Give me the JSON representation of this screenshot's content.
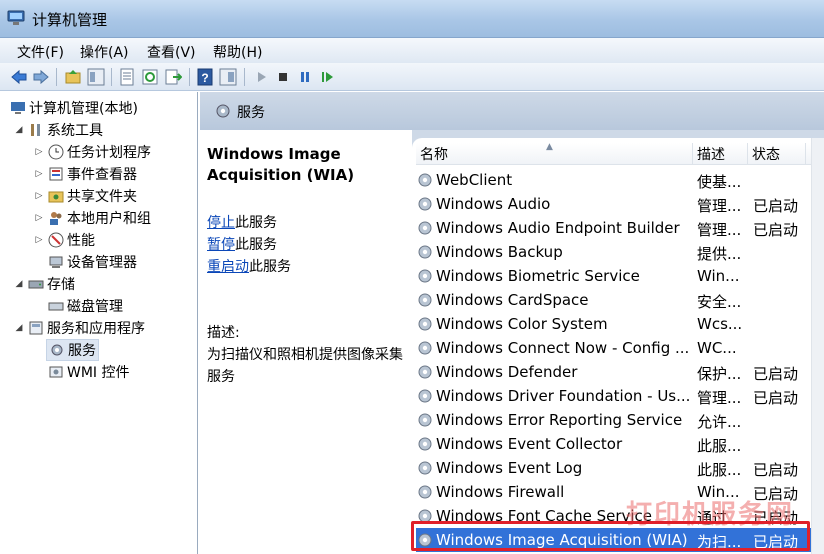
{
  "window": {
    "title": "计算机管理"
  },
  "menu": [
    "文件(F)",
    "操作(A)",
    "查看(V)",
    "帮助(H)"
  ],
  "toolbar": {
    "icons": [
      "back-icon",
      "forward-icon",
      "up-folder-icon",
      "show-tree-icon",
      "properties-icon",
      "refresh-icon",
      "export-icon",
      "help-icon",
      "show-pane-icon",
      "start-icon",
      "stop-icon",
      "pause-icon",
      "restart-icon"
    ]
  },
  "tree": {
    "root": "计算机管理(本地)",
    "system_tools": "系统工具",
    "task_scheduler": "任务计划程序",
    "event_viewer": "事件查看器",
    "shared_folders": "共享文件夹",
    "local_users": "本地用户和组",
    "performance": "性能",
    "device_manager": "设备管理器",
    "storage": "存储",
    "disk_management": "磁盘管理",
    "services_apps": "服务和应用程序",
    "services": "服务",
    "wmi": "WMI 控件"
  },
  "header": {
    "title": "服务"
  },
  "extended": {
    "service_title_line1": "Windows Image",
    "service_title_line2": "Acquisition (WIA)",
    "stop_link": "停止",
    "stop_suffix": "此服务",
    "pause_link": "暂停",
    "pause_suffix": "此服务",
    "restart_link": "重启动",
    "restart_suffix": "此服务",
    "desc_label": "描述:",
    "desc_text": "为扫描仪和照相机提供图像采集服务"
  },
  "columns": {
    "name": "名称",
    "desc": "描述",
    "status": "状态"
  },
  "services": [
    {
      "name": "WebClient",
      "desc": "使基...",
      "status": ""
    },
    {
      "name": "Windows Audio",
      "desc": "管理...",
      "status": "已启动"
    },
    {
      "name": "Windows Audio Endpoint Builder",
      "desc": "管理...",
      "status": "已启动"
    },
    {
      "name": "Windows Backup",
      "desc": "提供...",
      "status": ""
    },
    {
      "name": "Windows Biometric Service",
      "desc": "Win...",
      "status": ""
    },
    {
      "name": "Windows CardSpace",
      "desc": "安全...",
      "status": ""
    },
    {
      "name": "Windows Color System",
      "desc": "Wcs...",
      "status": ""
    },
    {
      "name": "Windows Connect Now - Config ...",
      "desc": "WC...",
      "status": ""
    },
    {
      "name": "Windows Defender",
      "desc": "保护...",
      "status": "已启动"
    },
    {
      "name": "Windows Driver Foundation - Us...",
      "desc": "管理...",
      "status": "已启动"
    },
    {
      "name": "Windows Error Reporting Service",
      "desc": "允许...",
      "status": ""
    },
    {
      "name": "Windows Event Collector",
      "desc": "此服...",
      "status": ""
    },
    {
      "name": "Windows Event Log",
      "desc": "此服...",
      "status": "已启动"
    },
    {
      "name": "Windows Firewall",
      "desc": "Win...",
      "status": "已启动"
    },
    {
      "name": "Windows Font Cache Service",
      "desc": "通过...",
      "status": "已启动"
    },
    {
      "name": "Windows Image Acquisition (WIA)",
      "desc": "为扫...",
      "status": "已启动"
    }
  ],
  "watermark": "打印机服务网",
  "colors": {
    "selection": "#3272d8",
    "highlight_box": "#e0202a",
    "link": "#0b47b8"
  }
}
